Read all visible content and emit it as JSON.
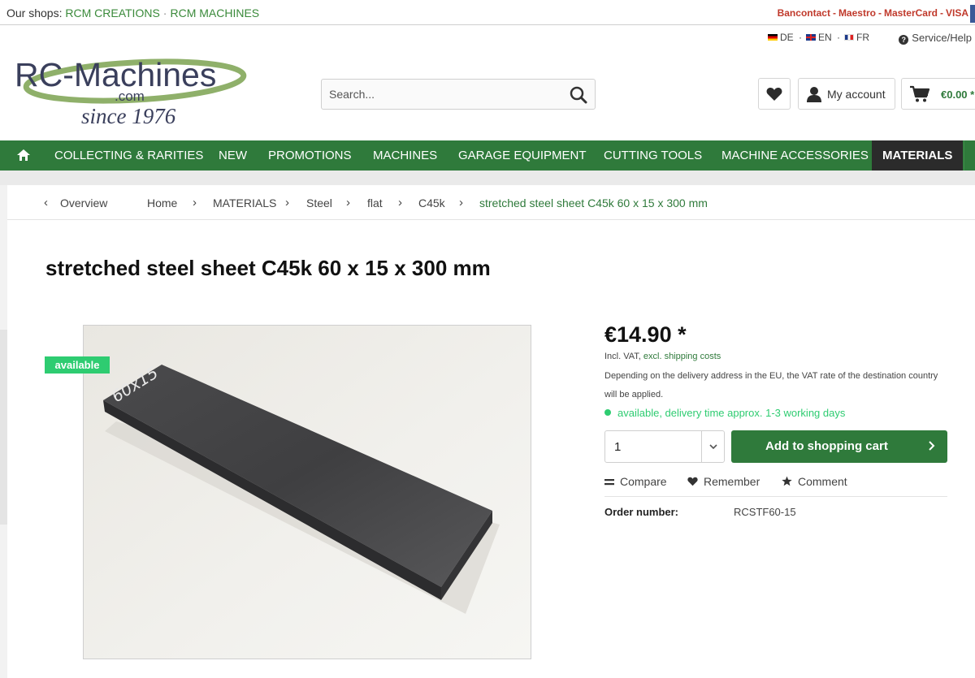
{
  "topbar": {
    "shops_label": "Our shops:",
    "shop_1": "RCM CREATIONS",
    "shop_sep": "·",
    "shop_2": "RCM MACHINES",
    "payments": [
      "Bancontact",
      "Maestro",
      "MasterCard",
      "VISA"
    ],
    "payment_sep": "-"
  },
  "header": {
    "languages": [
      "DE",
      "EN",
      "FR"
    ],
    "lang_sep": "·",
    "help": "Service/Help",
    "logo": {
      "name": "RC-Machines",
      "domain": ".com",
      "tagline": "since 1976"
    },
    "search": {
      "placeholder": "Search..."
    },
    "account": "My account",
    "cart_total": "€0.00 *"
  },
  "nav": {
    "items": [
      "COLLECTING & RARITIES",
      "NEW",
      "PROMOTIONS",
      "MACHINES",
      "GARAGE EQUIPMENT",
      "CUTTING TOOLS",
      "MACHINE ACCESSORIES",
      "MATERIALS"
    ],
    "active": "MATERIALS"
  },
  "breadcrumb": {
    "overview": "Overview",
    "items": [
      "Home",
      "MATERIALS",
      "Steel",
      "flat",
      "C45k"
    ],
    "current": "stretched steel sheet C45k 60 x 15 x 300 mm"
  },
  "product": {
    "title": "stretched steel sheet C45k 60 x 15 x 300 mm",
    "badge": "available",
    "image_marking": "60x15",
    "price": "€14.90 *",
    "vat_prefix": "Incl. VAT,",
    "vat_link": "excl. shipping costs",
    "vat_note": "Depending on the delivery address in the EU, the VAT rate of the destination country will be applied.",
    "availability": "available, delivery time approx. 1-3 working days",
    "quantity": "1",
    "add_to_cart": "Add to shopping cart",
    "actions": [
      "Compare",
      "Remember",
      "Comment"
    ],
    "order_label": "Order number:",
    "order_number": "RCSTF60-15"
  },
  "colors": {
    "brand_green": "#2f7a3b",
    "available_green": "#2ecc71",
    "payment_red": "#c0392b",
    "nav_active": "#2b2b2b"
  }
}
